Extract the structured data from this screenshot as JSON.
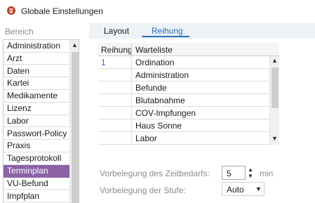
{
  "window": {
    "title": "Globale Einstellungen",
    "icon": "app-logo-icon"
  },
  "sidebar": {
    "header": "Bereich",
    "items": [
      {
        "label": "Administration",
        "selected": false
      },
      {
        "label": "Arzt",
        "selected": false
      },
      {
        "label": "Daten",
        "selected": false
      },
      {
        "label": "Kartei",
        "selected": false
      },
      {
        "label": "Medikamente",
        "selected": false
      },
      {
        "label": "Lizenz",
        "selected": false
      },
      {
        "label": "Labor",
        "selected": false
      },
      {
        "label": "Passwort-Policy",
        "selected": false
      },
      {
        "label": "Praxis",
        "selected": false
      },
      {
        "label": "Tagesprotokoll",
        "selected": false
      },
      {
        "label": "Terminplan",
        "selected": true
      },
      {
        "label": "VU-Befund",
        "selected": false
      },
      {
        "label": "Impfplan",
        "selected": false
      }
    ]
  },
  "tabs": [
    {
      "label": "Layout",
      "active": false
    },
    {
      "label": "Reihung",
      "active": true
    }
  ],
  "grid": {
    "columns": [
      "Reihung",
      "Warteliste"
    ],
    "rows": [
      {
        "reihung": "1",
        "warteliste": "Ordination"
      },
      {
        "reihung": "",
        "warteliste": "Administration"
      },
      {
        "reihung": "",
        "warteliste": "Befunde"
      },
      {
        "reihung": "",
        "warteliste": "Blutabnahme"
      },
      {
        "reihung": "",
        "warteliste": "COV-Impfungen"
      },
      {
        "reihung": "",
        "warteliste": "Haus Sonne"
      },
      {
        "reihung": "",
        "warteliste": "Labor"
      }
    ]
  },
  "form": {
    "zeitbedarf_label": "Vorbelegung des Zeitbedarfs:",
    "zeitbedarf_value": "5",
    "zeitbedarf_unit": "min",
    "stufe_label": "Vorbelegung der Stufe:",
    "stufe_value": "Auto"
  },
  "colors": {
    "selection": "#8b63a6",
    "accent": "#2a6ebb",
    "tab_bar": "#eef1f6"
  }
}
